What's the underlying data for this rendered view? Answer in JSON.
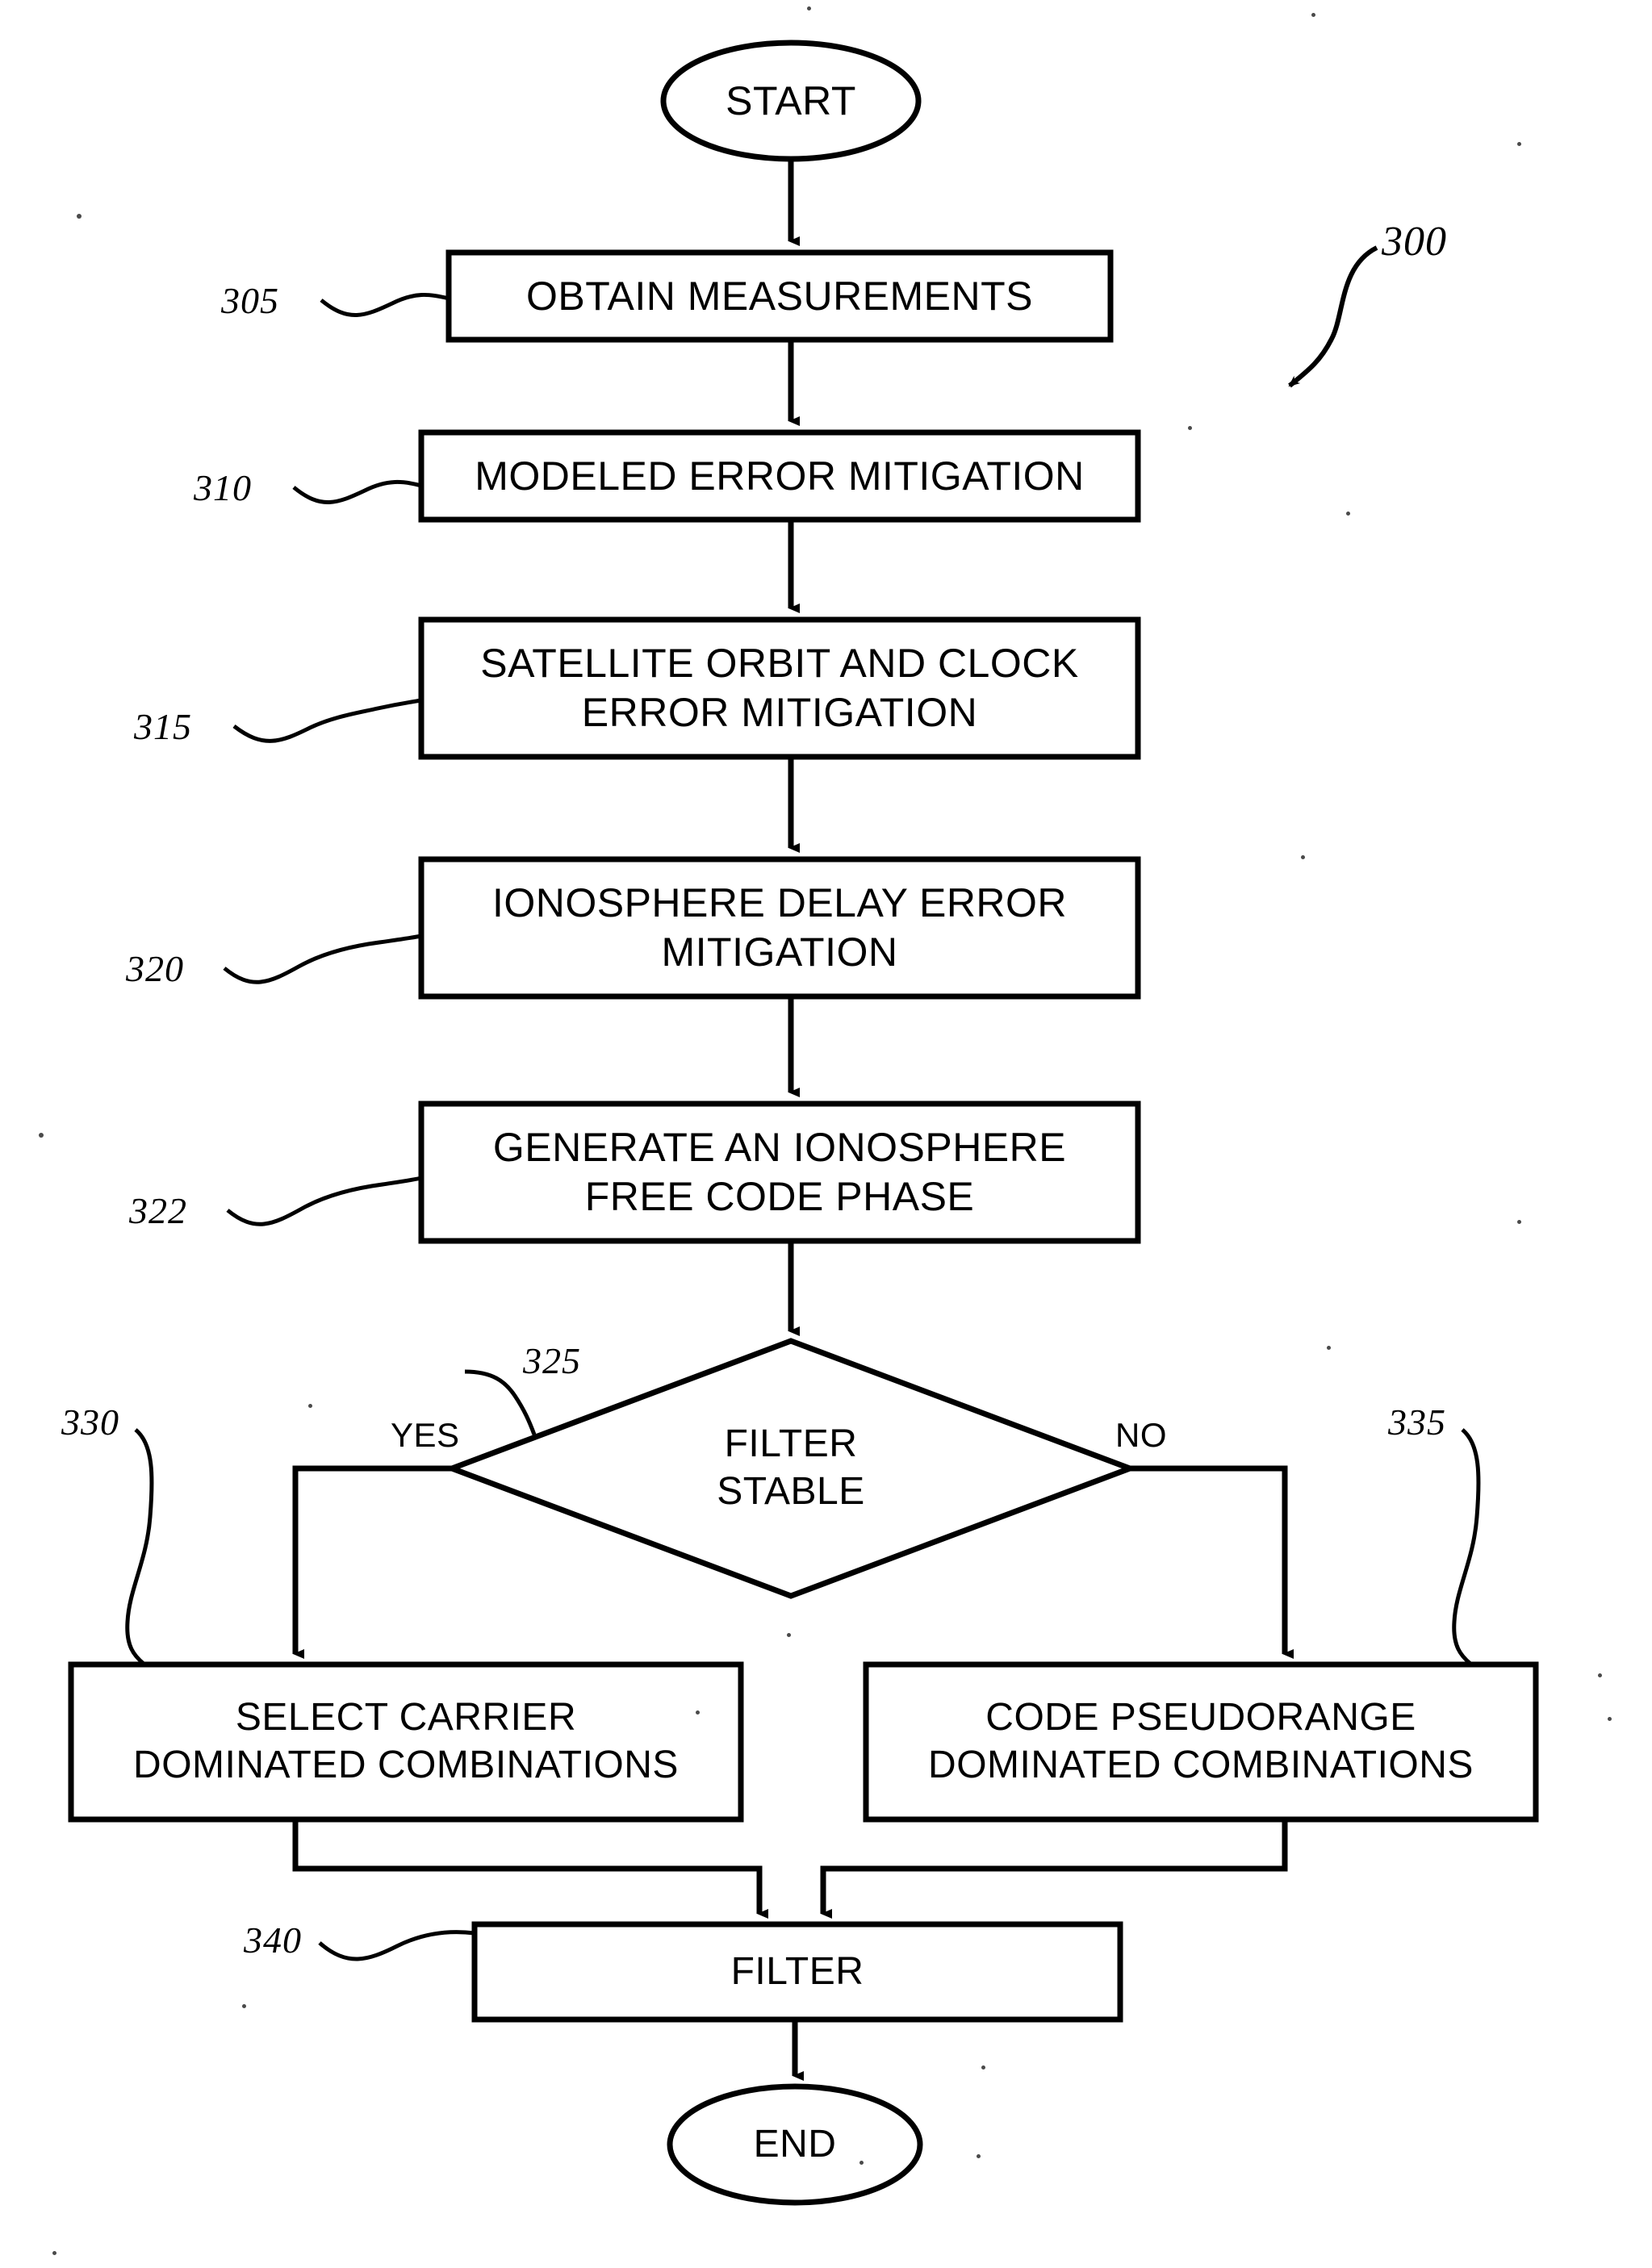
{
  "figure": {
    "reference_numeral": "300",
    "type": "flowchart"
  },
  "nodes": {
    "start": {
      "label": "START",
      "shape": "ellipse"
    },
    "step305": {
      "ref": "305",
      "label": "OBTAIN MEASUREMENTS",
      "shape": "process"
    },
    "step310": {
      "ref": "310",
      "label": "MODELED ERROR MITIGATION",
      "shape": "process"
    },
    "step315": {
      "ref": "315",
      "label": "SATELLITE ORBIT AND CLOCK\nERROR MITIGATION",
      "shape": "process"
    },
    "step320": {
      "ref": "320",
      "label": "IONOSPHERE DELAY ERROR\nMITIGATION",
      "shape": "process"
    },
    "step322": {
      "ref": "322",
      "label": "GENERATE AN IONOSPHERE\nFREE CODE PHASE",
      "shape": "process"
    },
    "decision325": {
      "ref": "325",
      "label": "FILTER\nSTABLE",
      "shape": "diamond"
    },
    "step330": {
      "ref": "330",
      "label": "SELECT CARRIER\nDOMINATED COMBINATIONS",
      "shape": "process"
    },
    "step335": {
      "ref": "335",
      "label": "CODE PSEUDORANGE\nDOMINATED COMBINATIONS",
      "shape": "process"
    },
    "step340": {
      "ref": "340",
      "label": "FILTER",
      "shape": "process"
    },
    "end": {
      "label": "END",
      "shape": "ellipse"
    }
  },
  "branches": {
    "yes": "YES",
    "no": "NO"
  },
  "colors": {
    "ink": "#000000",
    "paper": "#ffffff"
  }
}
